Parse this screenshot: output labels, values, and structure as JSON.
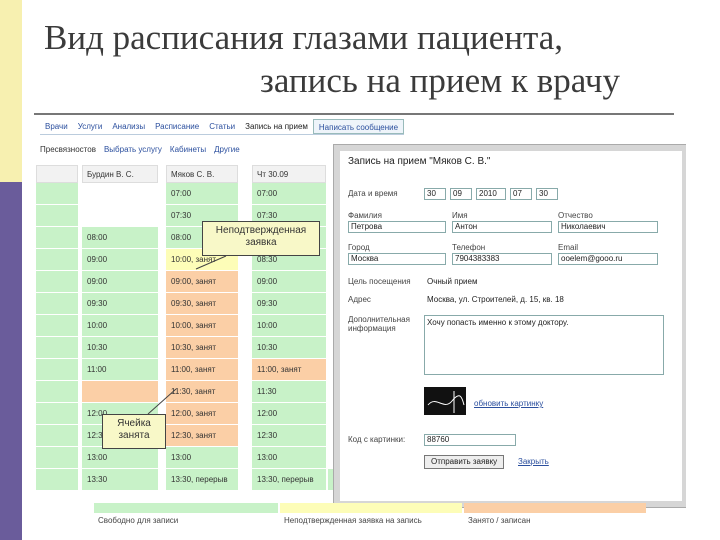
{
  "slide": {
    "title_line1": "Вид расписания глазами пациента,",
    "title_line2": "запись на прием к врачу"
  },
  "nav": {
    "tabs": [
      "Врачи",
      "Услуги",
      "Анализы",
      "Расписание",
      "Статьи",
      "Запись на прием",
      "Написать сообщение"
    ]
  },
  "subnav": [
    "Пресвязностов",
    "Выбрать услугу",
    "Кабинеты",
    "Другие"
  ],
  "schedule": {
    "columns": [
      {
        "head": "",
        "cells": [
          {
            "t": "",
            "c": "green"
          },
          {
            "t": "",
            "c": "green"
          },
          {
            "t": "",
            "c": "green"
          },
          {
            "t": "",
            "c": "green"
          },
          {
            "t": "",
            "c": "green"
          },
          {
            "t": "",
            "c": "green"
          },
          {
            "t": "",
            "c": "green"
          },
          {
            "t": "",
            "c": "green"
          },
          {
            "t": "",
            "c": "green"
          },
          {
            "t": "",
            "c": "green"
          },
          {
            "t": "",
            "c": "green"
          },
          {
            "t": "",
            "c": "green"
          },
          {
            "t": "",
            "c": "green"
          },
          {
            "t": "",
            "c": "green"
          }
        ]
      },
      {
        "head": "Бурдин В. С.",
        "cells": [
          {
            "t": "",
            "c": "blank"
          },
          {
            "t": "",
            "c": "blank"
          },
          {
            "t": "08:00",
            "c": "green"
          },
          {
            "t": "09:00",
            "c": "green"
          },
          {
            "t": "09:00",
            "c": "green"
          },
          {
            "t": "09:30",
            "c": "green"
          },
          {
            "t": "10:00",
            "c": "green"
          },
          {
            "t": "10:30",
            "c": "green"
          },
          {
            "t": "11:00",
            "c": "green"
          },
          {
            "t": "",
            "c": "orange"
          },
          {
            "t": "12:00",
            "c": "green"
          },
          {
            "t": "12:30",
            "c": "green"
          },
          {
            "t": "13:00",
            "c": "green"
          },
          {
            "t": "13:30",
            "c": "green"
          }
        ]
      },
      {
        "head": "Мяков С. В.",
        "cells": [
          {
            "t": "07:00",
            "c": "green"
          },
          {
            "t": "07:30",
            "c": "green"
          },
          {
            "t": "08:00",
            "c": "green"
          },
          {
            "t": "10:00, занят",
            "c": "yellow"
          },
          {
            "t": "09:00, занят",
            "c": "orange"
          },
          {
            "t": "09:30, занят",
            "c": "orange"
          },
          {
            "t": "10:00, занят",
            "c": "orange"
          },
          {
            "t": "10:30, занят",
            "c": "orange"
          },
          {
            "t": "11:00, занят",
            "c": "orange"
          },
          {
            "t": "11:30, занят",
            "c": "orange"
          },
          {
            "t": "12:00, занят",
            "c": "orange"
          },
          {
            "t": "12:30, занят",
            "c": "orange"
          },
          {
            "t": "13:00",
            "c": "green"
          },
          {
            "t": "13:30, перерыв",
            "c": "green"
          }
        ]
      },
      {
        "head": "Чт 30.09",
        "cells": [
          {
            "t": "07:00",
            "c": "green"
          },
          {
            "t": "07:30",
            "c": "green"
          },
          {
            "t": "08:00",
            "c": "green"
          },
          {
            "t": "08:30",
            "c": "green"
          },
          {
            "t": "09:00",
            "c": "green"
          },
          {
            "t": "09:30",
            "c": "green"
          },
          {
            "t": "10:00",
            "c": "green"
          },
          {
            "t": "10:30",
            "c": "green"
          },
          {
            "t": "11:00, занят",
            "c": "orange"
          },
          {
            "t": "11:30",
            "c": "green"
          },
          {
            "t": "12:00",
            "c": "green"
          },
          {
            "t": "12:30",
            "c": "green"
          },
          {
            "t": "13:00",
            "c": "green"
          },
          {
            "t": "13:30, перерыв",
            "c": "green"
          }
        ]
      }
    ],
    "extra_bottom": [
      "13:30, перерыв",
      "13:30, перерыв",
      "13:30"
    ]
  },
  "callouts": {
    "unconfirmed": "Неподтвержденная заявка",
    "occupied": "Ячейка занята"
  },
  "dialog": {
    "title": "Запись на прием \"Мяков С. В.\"",
    "date_label": "Дата и время",
    "date_day": "30",
    "date_month": "09",
    "date_year": "2010",
    "time_h": "07",
    "time_m": "30",
    "lastname_label": "Фамилия",
    "lastname": "Петрова",
    "firstname_label": "Имя",
    "firstname": "Антон",
    "patronymic_label": "Отчество",
    "patronymic": "Николаевич",
    "city_label": "Город",
    "city": "Москва",
    "phone_label": "Телефон",
    "phone": "7904383383",
    "email_label": "Email",
    "email": "ooelem@gooo.ru",
    "purpose_label": "Цель посещения",
    "purpose": "Очный прием",
    "address_label": "Адрес",
    "address": "Москва, ул. Строителей, д. 15, кв. 18",
    "extra_label": "Дополнительная информация",
    "extra": "Хочу попасть именно к этому доктору.",
    "captcha_link": "обновить картинку",
    "captcha_label": "Код с картинки:",
    "captcha_value": "88760",
    "submit": "Отправить заявку",
    "cancel": "Закрыть"
  },
  "legend": [
    {
      "label": "Свободно для записи",
      "color": "#c8f2c8"
    },
    {
      "label": "Неподтвержденная заявка на запись",
      "color": "#fdfdb8"
    },
    {
      "label": "Занято / записан",
      "color": "#fbcfa6"
    }
  ],
  "colors": {
    "green": "#c8f2c8",
    "yellow": "#fdfdb8",
    "orange": "#fbcfa6",
    "accent": "#6a5c9b"
  }
}
